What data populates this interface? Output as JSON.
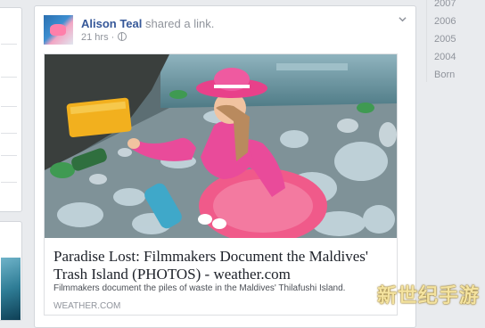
{
  "post": {
    "author": "Alison Teal",
    "action_text": "shared a",
    "link_word": "link.",
    "timestamp": "21 hrs",
    "separator": "·"
  },
  "link": {
    "title": "Paradise Lost: Filmmakers Document the Maldives' Trash Island (PHOTOS) - weather.com",
    "description": "Filmmakers document the piles of waste in the Maldives' Thilafushi Island.",
    "domain": "WEATHER.COM"
  },
  "years": [
    "2007",
    "2006",
    "2005",
    "2004",
    "Born"
  ],
  "watermark": "新世纪手游",
  "colors": {
    "author": "#365899",
    "muted": "#90949c",
    "background": "#e9ebee"
  },
  "icons": [
    "globe-icon",
    "chevron-down-icon"
  ]
}
